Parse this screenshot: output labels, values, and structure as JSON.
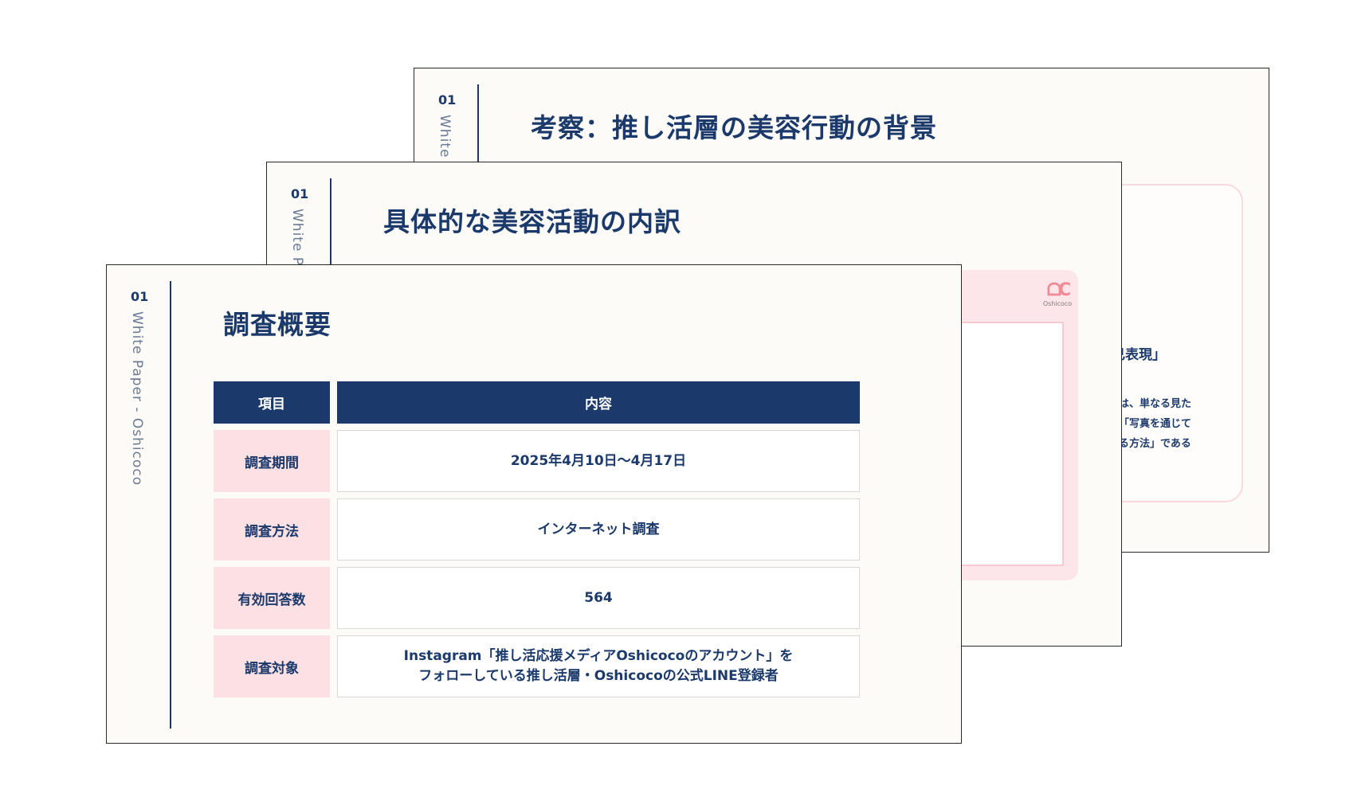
{
  "slides": {
    "back": {
      "number": "01",
      "side_label": "White P",
      "title": "考察：推し活層の美容行動の背景",
      "card_heading": "己表現」",
      "card_lines": [
        "は、単なる見た",
        "「写真を通じて",
        "る方法」である"
      ]
    },
    "middle": {
      "number": "01",
      "side_label": "White Pa",
      "title": "具体的な美容活動の内訳",
      "logo_text": "Oshicoco"
    },
    "front": {
      "number": "01",
      "side_label": "White Paper - Oshicoco",
      "title": "調査概要",
      "table": {
        "headers": {
          "item": "項目",
          "content": "内容"
        },
        "rows": [
          {
            "item": "調査期間",
            "content": "2025年4月10日〜4月17日"
          },
          {
            "item": "調査方法",
            "content": "インターネット調査"
          },
          {
            "item": "有効回答数",
            "content": "564"
          },
          {
            "item": "調査対象",
            "content_lines": [
              "Instagram「推し活応援メディアOshicocoのアカウント」を",
              "フォローしている推し活層・Oshicocoの公式LINE登録者"
            ]
          }
        ]
      }
    }
  },
  "colors": {
    "navy": "#1b3a6b",
    "pink": "#fde0e4",
    "paper": "#fdfbf7"
  }
}
